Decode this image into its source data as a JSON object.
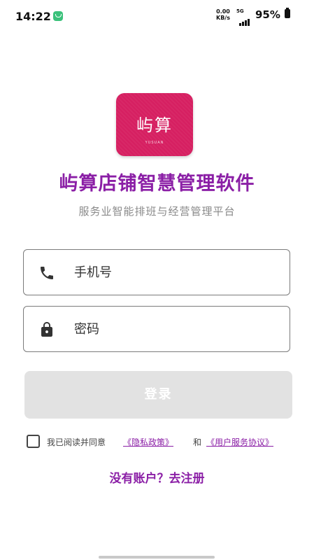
{
  "status_bar": {
    "time": "14:22",
    "net_speed_value": "0.00",
    "net_speed_unit": "KB/s",
    "network": "5G",
    "battery": "95%"
  },
  "logo": {
    "main_text": "屿算",
    "sub_text": "YUSUAN"
  },
  "app": {
    "title": "屿算店铺智慧管理软件",
    "subtitle": "服务业智能排班与经营管理平台"
  },
  "form": {
    "phone": {
      "placeholder": "手机号",
      "value": "",
      "icon": "phone-icon"
    },
    "password": {
      "placeholder": "密码",
      "value": "",
      "icon": "lock-icon"
    },
    "login_label": "登录"
  },
  "agreement": {
    "checked": false,
    "prefix": "我已阅读并同意",
    "privacy_link": "《隐私政策》",
    "and": "和",
    "terms_link": "《用户服务协议》"
  },
  "register_link": "没有账户？去注册",
  "colors": {
    "brand": "#d61f61",
    "accent": "#8b1fa6",
    "button_disabled": "#e2e2e2"
  }
}
